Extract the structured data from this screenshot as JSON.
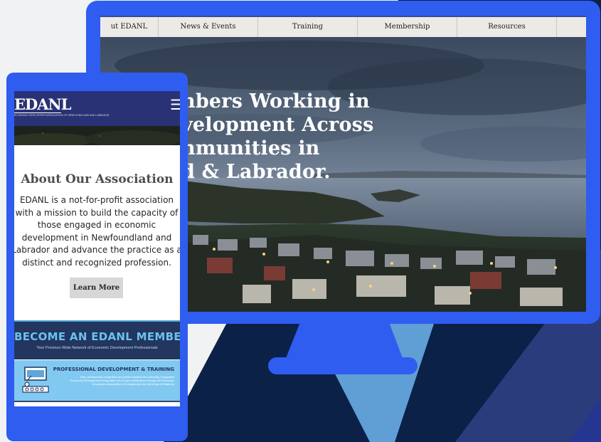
{
  "colors": {
    "device_blue": "#2f5df0",
    "navy_bg": "#0b2147",
    "phone_header": "#293274",
    "member_bg": "#22365f",
    "member_accent": "#6cc2ec",
    "pd_bg": "#82c9f2"
  },
  "desktop": {
    "nav": {
      "items": [
        {
          "label": "ut EDANL"
        },
        {
          "label": "News & Events"
        },
        {
          "label": "Training"
        },
        {
          "label": "Membership"
        },
        {
          "label": "Resources"
        },
        {
          "label": ""
        }
      ]
    },
    "hero_lines": [
      "nbers Working in",
      "velopment Across",
      "nmunities in",
      "d & Labrador."
    ]
  },
  "mobile": {
    "logo_text": "EDANL",
    "logo_subtitle": "ECONOMIC DEVELOPERS ASSOCIATION OF NEWFOUNDLAND AND LABRADOR",
    "menu_icon": "hamburger-icon",
    "about": {
      "title": "About Our Association",
      "text": "EDANL is a not-for-profit association with a mission to build the capacity of those engaged in economic development in Newfoundland and Labrador and advance the practice as a distinct and recognized profession.",
      "button_label": "Learn More"
    },
    "membership": {
      "title": "BECOME AN EDANL MEMBER",
      "subtitle": "Your Province-Wide Network of Economic Development Professionals"
    },
    "professional_development": {
      "title": "PROFESSIONAL DEVELOPMENT & TRAINING",
      "text": "Earn professional recognition and points towards the nationally recognized Economic Development Designation (Ec.D) and certification through the Economic Developers Association of Canada and the University of Waterloo",
      "icon": "presentation-board-icon"
    }
  }
}
